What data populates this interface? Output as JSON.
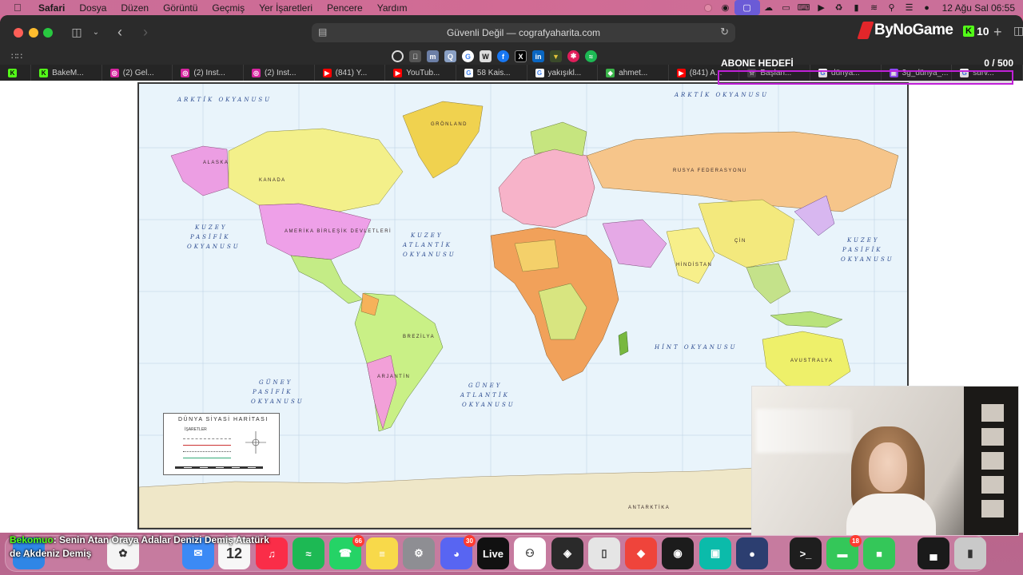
{
  "menubar": {
    "items": [
      "Safari",
      "Dosya",
      "Düzen",
      "Görüntü",
      "Geçmiş",
      "Yer İşaretleri",
      "Pencere",
      "Yardım"
    ],
    "clock": "12 Ağu Sal  06:55"
  },
  "toolbar": {
    "address": "Güvenli Değil — cografyaharita.com",
    "bynogame": "ByNoGame",
    "kick_viewers": "10",
    "newtab": "+"
  },
  "tabs": [
    "",
    "BakeM...",
    "(2) Gel...",
    "(2) Inst...",
    "(2) Inst...",
    "(841) Y...",
    "YouTub...",
    "58 Kais...",
    "yakışıkl...",
    "ahmet...",
    "(841) A...",
    "Başlan...",
    "dünya...",
    "3g_dünya_...",
    "surv..."
  ],
  "tab_icons": [
    "kick",
    "kick",
    "instagram",
    "instagram",
    "instagram",
    "youtube",
    "youtube",
    "google",
    "google",
    "leaf",
    "youtube",
    "star",
    "google",
    "twitch",
    "google"
  ],
  "abone": {
    "title": "ABONE HEDEFİ",
    "count": "0  / 500",
    "progress": 0
  },
  "map": {
    "oceans": [
      "ARKTİK OKYANUSU",
      "ARKTİK OKYANUSU",
      "KUZEY",
      "PASİFİK",
      "OKYANUSU",
      "KUZEY",
      "ATLANTİK",
      "OKYANUSU",
      "KUZEY",
      "PASİFİK",
      "OKYANUSU",
      "HİNT OKYANUSU",
      "GÜNEY",
      "PASİFİK",
      "OKYANUSU",
      "GÜNEY",
      "ATLANTİK",
      "OKYANUSU"
    ],
    "countries": [
      "KANADA",
      "AMERİKA BİRLEŞİK DEVLETLERİ",
      "GRÖNLAND",
      "RUSYA FEDERASYONU",
      "ÇİN",
      "HİNDİSTAN",
      "BREZİLYA",
      "ARJANTİN",
      "AVUSTRALYA",
      "ANTARKTİKA",
      "ALASKA"
    ],
    "legend_title": "DÜNYA SİYASİ HARİTASI",
    "legend_sub": "İŞARETLER"
  },
  "chat": {
    "user": "Bekomuo",
    "message": ": Senin Atan Oraya Adalar Denizi Demiş Atatürk de Akdeniz Demiş"
  },
  "dock": {
    "apps": [
      "Finder",
      "Photos",
      "Mail",
      "Calendar",
      "Music",
      "Spotify",
      "WhatsApp",
      "Notes",
      "Settings",
      "Discord",
      "Live",
      "Copilot",
      "Unity",
      "Phone",
      "AnyDesk",
      "OBS",
      "Spark",
      "Globe",
      "Terminal",
      "Messages",
      "FaceTime",
      "Activity",
      "Trash"
    ],
    "calendar_day": "12",
    "whatsapp_badge": "66",
    "discord_badge": "30",
    "messages_badge": "18",
    "live_label": "Live"
  }
}
